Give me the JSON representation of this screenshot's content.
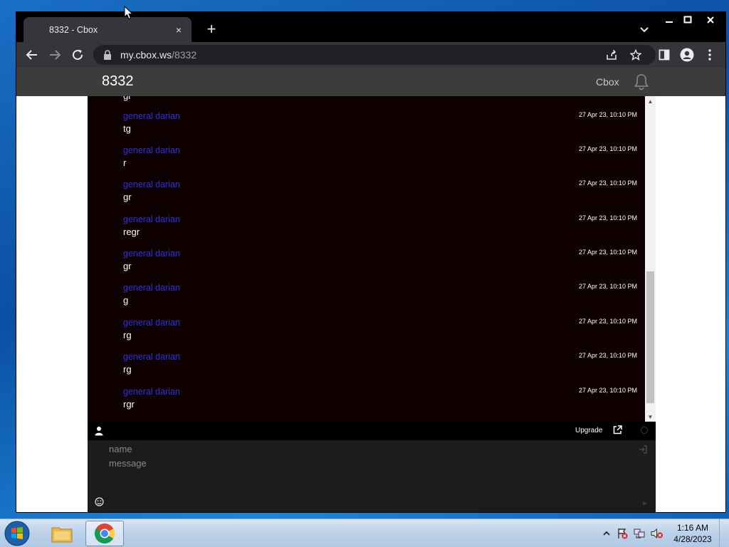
{
  "browser": {
    "tab_title": "8332 - Cbox",
    "tab_close": "×",
    "new_tab": "+",
    "url_host": "my.cbox.ws",
    "url_path": "/8332"
  },
  "app": {
    "title": "8332",
    "link": "Cbox"
  },
  "chat": {
    "partial_text": "gr",
    "messages": [
      {
        "author": "general darian",
        "text": "tg",
        "time": "27 Apr 23, 10:10 PM"
      },
      {
        "author": "general darian",
        "text": "r",
        "time": "27 Apr 23, 10:10 PM"
      },
      {
        "author": "general darian",
        "text": "gr",
        "time": "27 Apr 23, 10:10 PM"
      },
      {
        "author": "general darian",
        "text": "regr",
        "time": "27 Apr 23, 10:10 PM"
      },
      {
        "author": "general darian",
        "text": "gr",
        "time": "27 Apr 23, 10:10 PM"
      },
      {
        "author": "general darian",
        "text": "g",
        "time": "27 Apr 23, 10:10 PM"
      },
      {
        "author": "general darian",
        "text": "rg",
        "time": "27 Apr 23, 10:10 PM"
      },
      {
        "author": "general darian",
        "text": "rg",
        "time": "27 Apr 23, 10:10 PM"
      },
      {
        "author": "general darian",
        "text": "rgr",
        "time": "27 Apr 23, 10:10 PM"
      }
    ],
    "upgrade_label": "Upgrade",
    "name_placeholder": "name",
    "message_placeholder": "message"
  },
  "taskbar": {
    "time": "1:16 AM",
    "date": "4/28/2023"
  },
  "colors": {
    "author": "#3030d8",
    "chat_bg": "#0f0000",
    "appbar_bg": "#3c3c3c"
  }
}
